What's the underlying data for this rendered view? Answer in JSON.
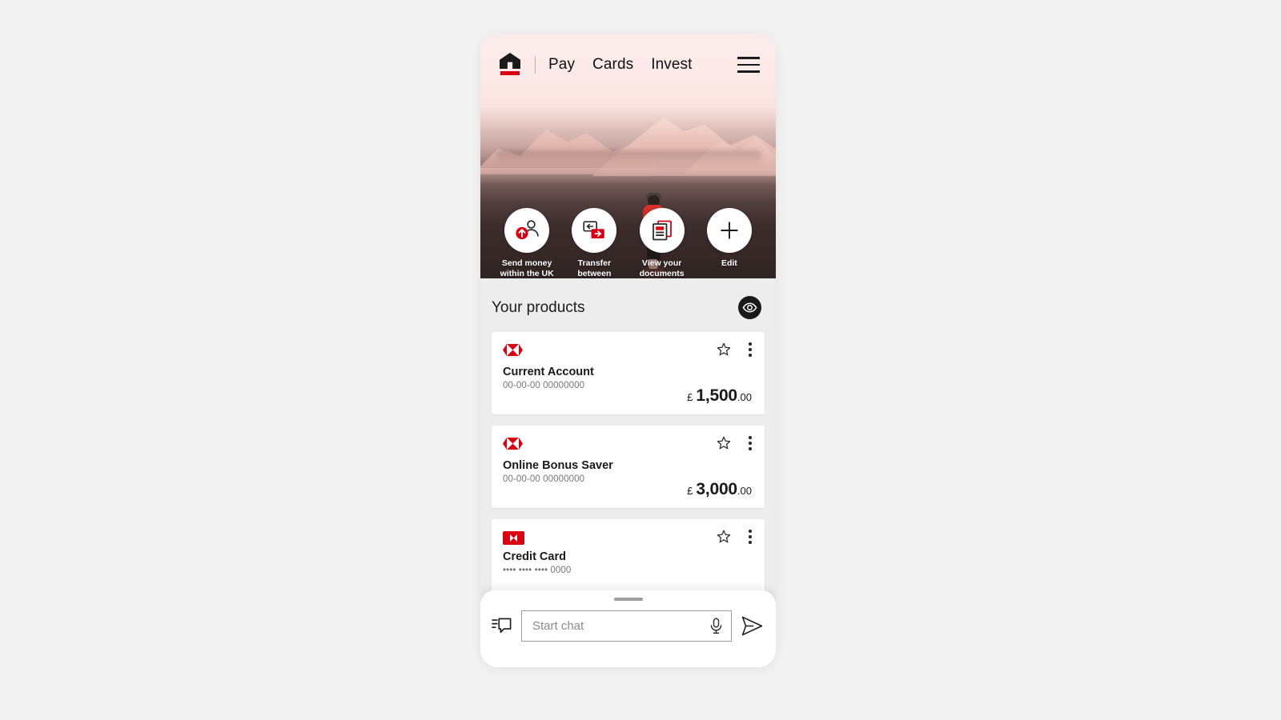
{
  "app": {
    "brand": "HSBC",
    "brand_red": "#db0011"
  },
  "topnav": {
    "home_icon": "home-icon",
    "menu_icon": "hamburger-menu-icon",
    "links": [
      {
        "label": "Pay"
      },
      {
        "label": "Cards"
      },
      {
        "label": "Invest"
      }
    ]
  },
  "quick_actions": [
    {
      "label": "Send money within the UK",
      "icon": "send-money-person-icon"
    },
    {
      "label": "Transfer between accounts",
      "icon": "transfer-accounts-icon"
    },
    {
      "label": "View your documents",
      "icon": "documents-icon"
    },
    {
      "label": "Edit",
      "icon": "plus-icon"
    }
  ],
  "products": {
    "title": "Your products",
    "visibility_toggle_icon": "eye-icon",
    "items": [
      {
        "brand_mark": "hsbc-hexagon-icon",
        "brand_style": "hexagon",
        "name": "Current Account",
        "number": "00-00-00 00000000",
        "currency": "£",
        "amount": "1,500",
        "cents": ".00",
        "star_icon": "star-outline-icon",
        "more_icon": "more-vertical-icon"
      },
      {
        "brand_mark": "hsbc-hexagon-icon",
        "brand_style": "hexagon",
        "name": "Online Bonus Saver",
        "number": "00-00-00 00000000",
        "currency": "£",
        "amount": "3,000",
        "cents": ".00",
        "star_icon": "star-outline-icon",
        "more_icon": "more-vertical-icon"
      },
      {
        "brand_mark": "hsbc-card-badge-icon",
        "brand_style": "badge",
        "name": "Credit Card",
        "number": "•••• •••• •••• 0000",
        "currency": "",
        "amount": "",
        "cents": "",
        "star_icon": "star-outline-icon",
        "more_icon": "more-vertical-icon"
      }
    ]
  },
  "chat": {
    "grab_handle": "drag-handle",
    "chat_list_icon": "chat-list-icon",
    "placeholder": "Start chat",
    "value": "",
    "mic_icon": "microphone-icon",
    "send_icon": "send-icon"
  }
}
